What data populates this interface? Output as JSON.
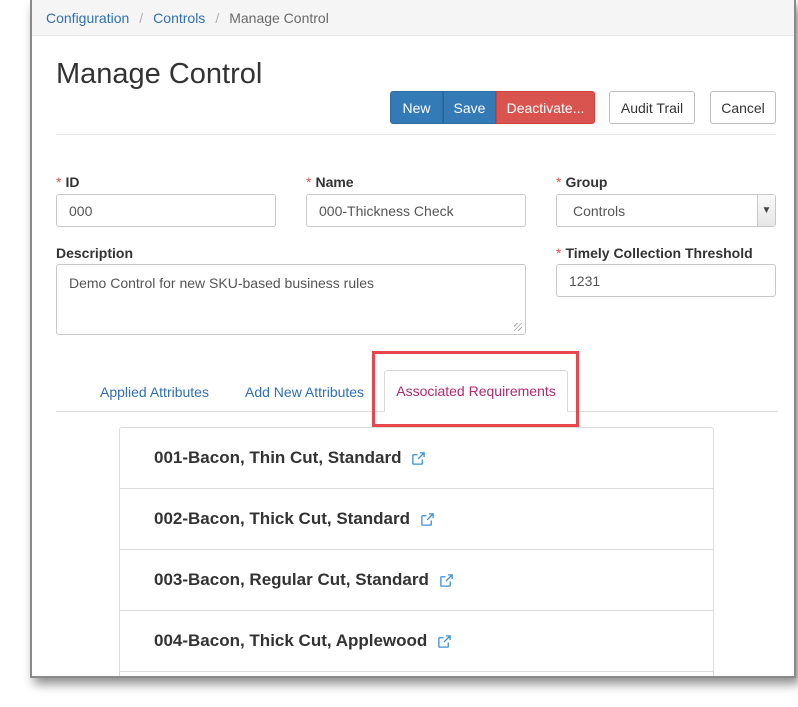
{
  "breadcrumb": {
    "items": [
      "Configuration",
      "Controls"
    ],
    "current": "Manage Control"
  },
  "page": {
    "title": "Manage Control"
  },
  "toolbar": {
    "new_label": "New",
    "save_label": "Save",
    "deactivate_label": "Deactivate...",
    "audit_trail_label": "Audit Trail",
    "cancel_label": "Cancel"
  },
  "form": {
    "id": {
      "label": "ID",
      "value": "000",
      "required": "*"
    },
    "name": {
      "label": "Name",
      "value": "000-Thickness Check",
      "required": "*"
    },
    "group": {
      "label": "Group",
      "value": "Controls",
      "required": "*"
    },
    "description": {
      "label": "Description",
      "value": "Demo Control for new SKU-based business rules"
    },
    "threshold": {
      "label": "Timely Collection Threshold",
      "value": "1231",
      "required": "*"
    }
  },
  "tabs": [
    {
      "label": "Applied Attributes"
    },
    {
      "label": "Add New Attributes"
    },
    {
      "label": "Associated Requirements"
    }
  ],
  "requirements": [
    {
      "label": "001-Bacon, Thin Cut, Standard"
    },
    {
      "label": "002-Bacon, Thick Cut, Standard"
    },
    {
      "label": "003-Bacon, Regular Cut, Standard"
    },
    {
      "label": "004-Bacon, Thick Cut, Applewood"
    }
  ],
  "colors": {
    "primary": "#337ab7",
    "danger": "#d9534f",
    "link": "#2f6fb3",
    "active_tab": "#b0286f",
    "highlight": "#e8474c"
  }
}
